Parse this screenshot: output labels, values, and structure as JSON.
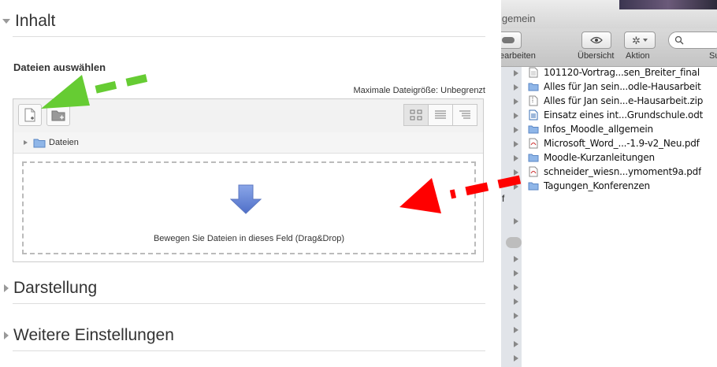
{
  "moodle": {
    "section_inhalt": "Inhalt",
    "select_files_label": "Dateien auswählen",
    "max_size": "Maximale Dateigröße: Unbegrenzt",
    "path_folder": "Dateien",
    "drop_text": "Bewegen Sie Dateien in dieses Feld (Drag&Drop)",
    "section_darstellung": "Darstellung",
    "section_weitere": "Weitere Einstellungen"
  },
  "finder": {
    "title": "lgemein",
    "toolbar": {
      "edit_label": "earbeiten",
      "view_label": "Übersicht",
      "action_label": "Aktion",
      "search_label": "Su"
    },
    "sidebar_partial_letter": "f",
    "files": [
      {
        "name": "101120-Vortrag...sen_Breiter_final",
        "icon": "document-icon"
      },
      {
        "name": "Alles für Jan sein...odle-Hausarbeit",
        "icon": "folder-icon"
      },
      {
        "name": "Alles für Jan sein...e-Hausarbeit.zip",
        "icon": "zip-icon"
      },
      {
        "name": "Einsatz eines int...Grundschule.odt",
        "icon": "odt-icon"
      },
      {
        "name": "Infos_Moodle_allgemein",
        "icon": "folder-icon"
      },
      {
        "name": "Microsoft_Word_...-1.9-v2_Neu.pdf",
        "icon": "pdf-icon"
      },
      {
        "name": "Moodle-Kurzanleitungen",
        "icon": "folder-icon"
      },
      {
        "name": "schneider_wiesn...ymoment9a.pdf",
        "icon": "pdf-icon"
      },
      {
        "name": "Tagungen_Konferenzen",
        "icon": "folder-icon"
      }
    ]
  },
  "colors": {
    "green_arrow": "#66cc33",
    "red_arrow": "#ff0000",
    "drop_arrow": "#6f8fd8",
    "folder_blue": "#8fb6e8"
  }
}
